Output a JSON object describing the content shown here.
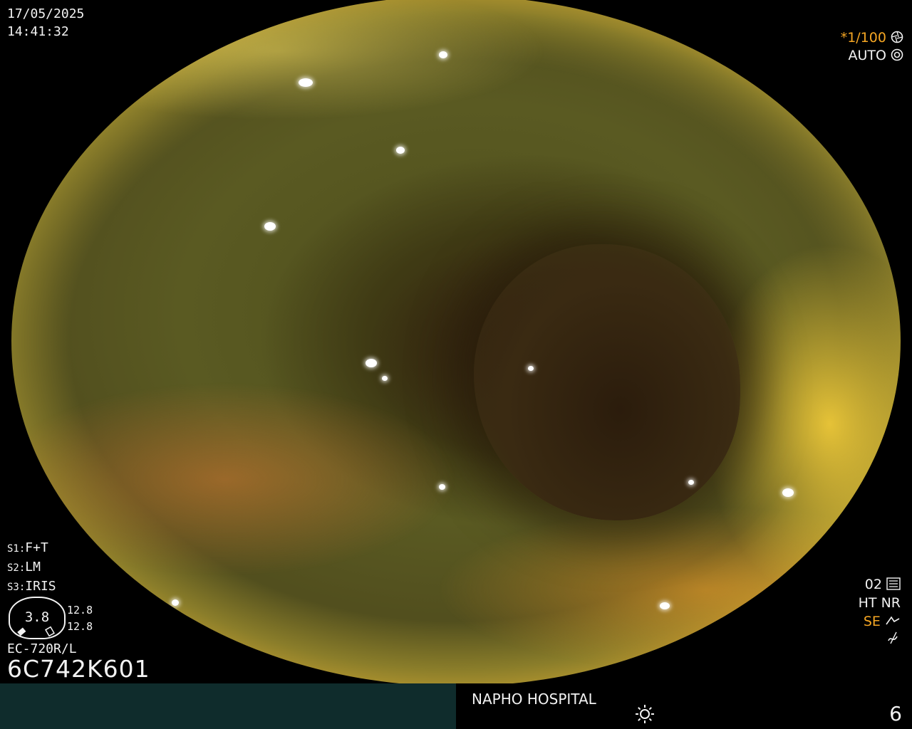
{
  "timestamp": {
    "date": "17/05/2025",
    "time": "14:41:32"
  },
  "settings": {
    "shutter": "*1/100",
    "mode": "AUTO"
  },
  "switches": [
    {
      "key": "S1",
      "value": "F+T"
    },
    {
      "key": "S2",
      "value": "LM"
    },
    {
      "key": "S3",
      "value": "IRIS"
    }
  ],
  "gauge": {
    "value": "3.8",
    "top": "12.8",
    "bottom": "12.8"
  },
  "scope": {
    "model": "EC-720R/L",
    "serial": "6C742K601"
  },
  "right_panel": {
    "line1": "02",
    "ht_nr": "HT NR",
    "se": "SE"
  },
  "footer": {
    "hospital": "NAPHO HOSPITAL",
    "page": "6"
  },
  "icons": [
    "aperture-icon",
    "auto-exposure-icon",
    "settings-bars-icon",
    "enhance-icon",
    "freeze-icon",
    "light-icon",
    "battery-icon"
  ],
  "colors": {
    "accent": "#f5a623",
    "footer_bg": "#0f2c2c"
  }
}
